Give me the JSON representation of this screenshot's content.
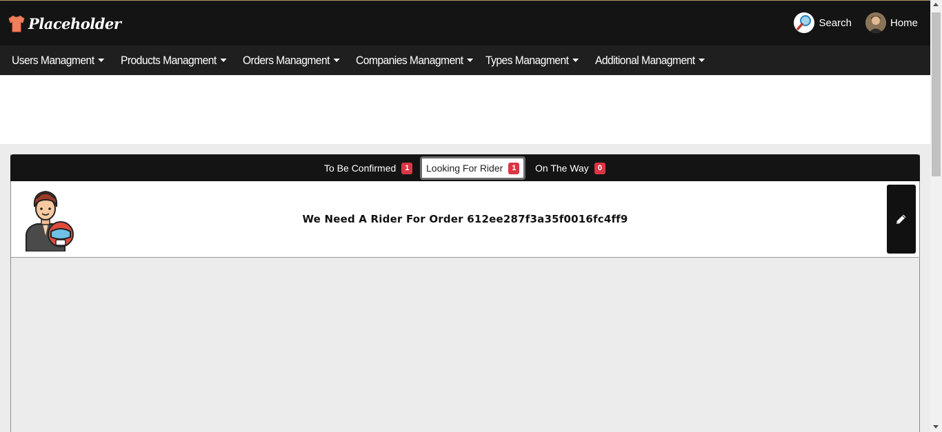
{
  "brand": {
    "name": "Placeholder"
  },
  "top_links": {
    "search_label": "Search",
    "home_label": "Home"
  },
  "nav": {
    "items": [
      {
        "label": "Users Managment"
      },
      {
        "label": "Products Managment"
      },
      {
        "label": "Orders Managment"
      },
      {
        "label": "Companies Managment"
      },
      {
        "label": "Types Managment"
      },
      {
        "label": "Additional Managment"
      }
    ]
  },
  "tabs": [
    {
      "label": "To Be Confirmed",
      "count": "1"
    },
    {
      "label": "Looking For Rider",
      "count": "1",
      "active": true
    },
    {
      "label": "On The Way",
      "count": "0"
    }
  ],
  "order": {
    "message": "We Need A Rider For Order 612ee287f3a35f0016fc4ff9"
  },
  "icons": {
    "logo": "shirt-icon",
    "search": "magnifier-icon",
    "home": "user-avatar",
    "caret": "caret-down-icon",
    "rider": "rider-with-helmet-icon",
    "edit": "pencil-icon"
  },
  "colors": {
    "topbar": "#141414",
    "navbar": "#1f1f1f",
    "badge": "#dc3545",
    "accent_logo": "#f07f5c"
  }
}
